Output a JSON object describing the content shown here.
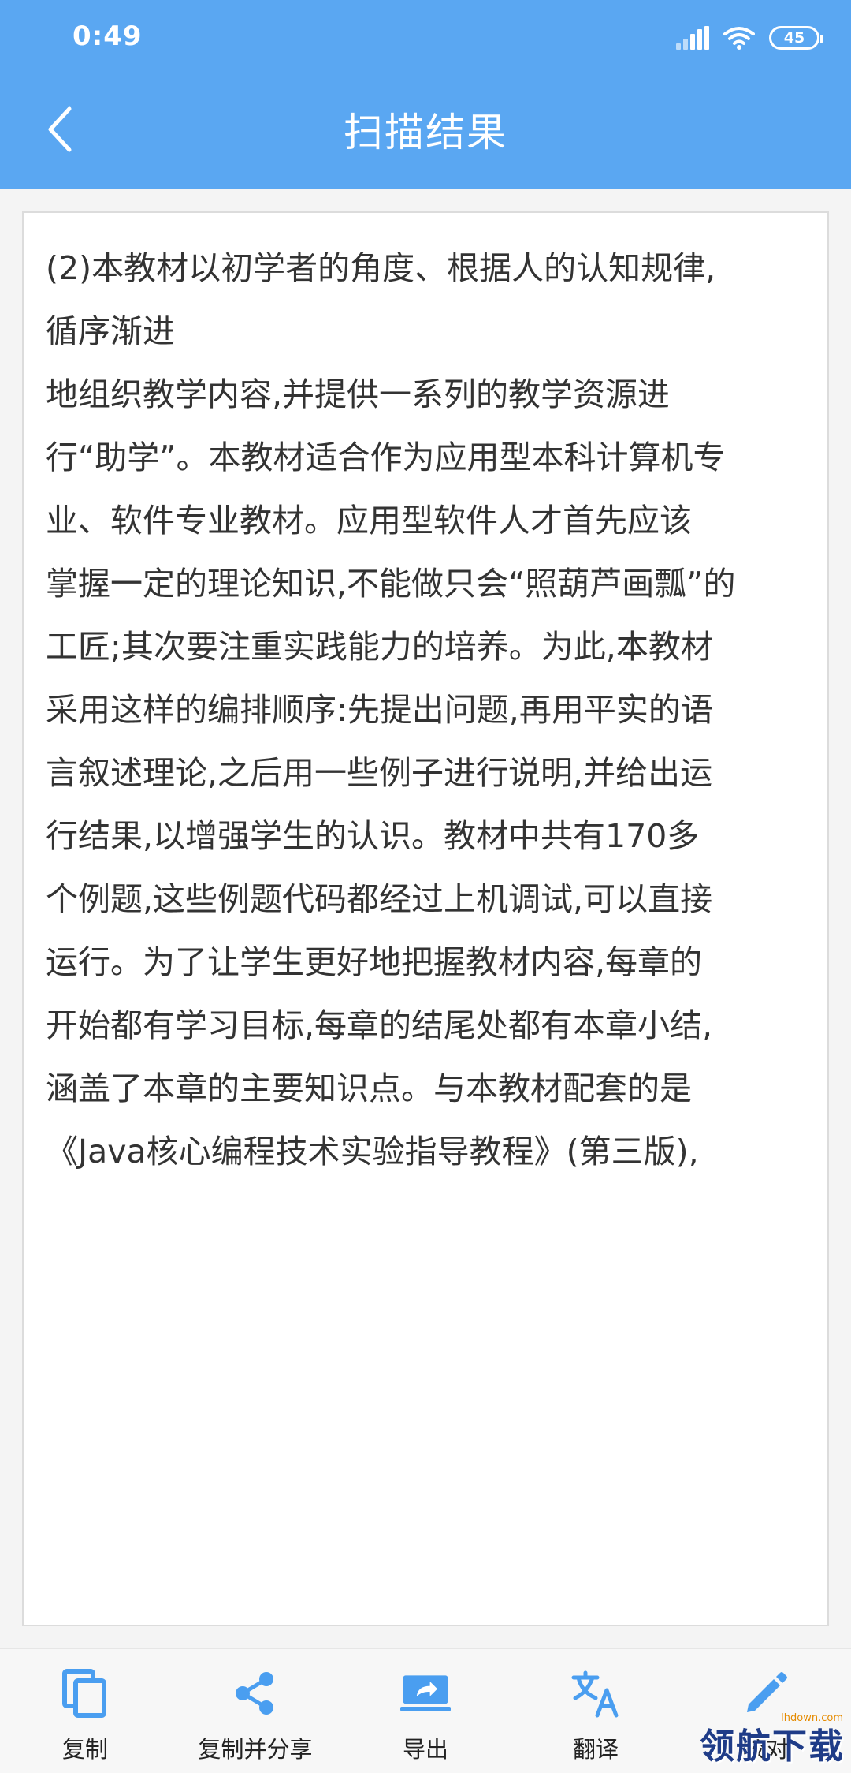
{
  "status_bar": {
    "time": "0:49",
    "battery": "45",
    "icons": [
      "signal-icon",
      "wifi-icon",
      "battery-icon"
    ]
  },
  "nav": {
    "back_icon": "chevron-left-icon",
    "title": "扫描结果"
  },
  "content": {
    "text": "(2)本教材以初学者的角度、根据人的认知规律,\n循序渐进\n地组织教学内容,并提供一系列的教学资源进\n行“助学”。本教材适合作为应用型本科计算机专\n业、软件专业教材。应用型软件人才首先应该\n掌握一定的理论知识,不能做只会“照葫芦画瓢”的\n工匠;其次要注重实践能力的培养。为此,本教材\n采用这样的编排顺序:先提出问题,再用平实的语\n言叙述理论,之后用一些例子进行说明,并给出运\n行结果,以增强学生的认识。教材中共有170多\n个例题,这些例题代码都经过上机调试,可以直接\n运行。为了让学生更好地把握教材内容,每章的\n开始都有学习目标,每章的结尾处都有本章小结,\n涵盖了本章的主要知识点。与本教材配套的是\n《Java核心编程技术实验指导教程》(第三版),"
  },
  "toolbar": {
    "items": [
      {
        "label": "复制",
        "icon": "copy-icon"
      },
      {
        "label": "复制并分享",
        "icon": "share-icon"
      },
      {
        "label": "导出",
        "icon": "export-icon"
      },
      {
        "label": "翻译",
        "icon": "translate-icon"
      },
      {
        "label": "校对",
        "icon": "edit-pencil-icon"
      }
    ]
  },
  "watermark": {
    "text": "领航下载",
    "domain": "lhdown.com"
  },
  "colors": {
    "header": "#5aa7f2",
    "icon": "#4a9ef0"
  }
}
